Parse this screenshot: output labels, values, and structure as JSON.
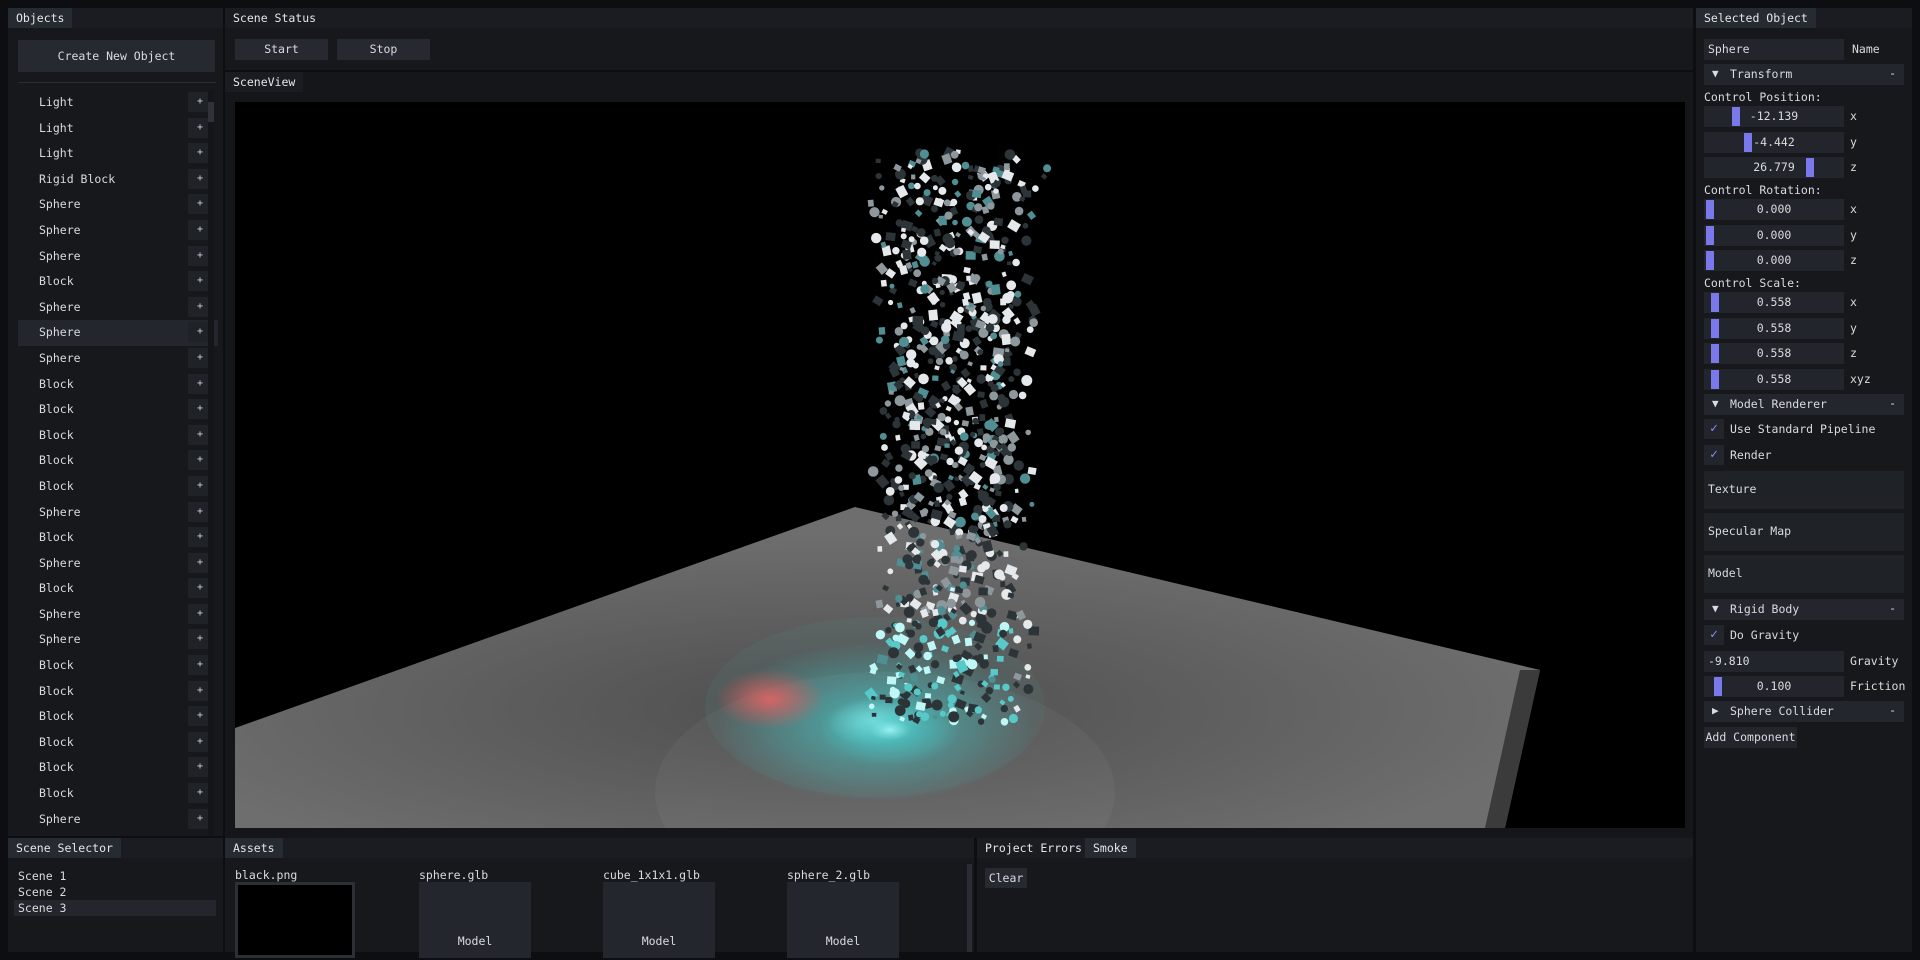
{
  "objects": {
    "title": "Objects",
    "create_button": "Create New Object",
    "add_symbol": "+",
    "items": [
      {
        "label": "Light"
      },
      {
        "label": "Light"
      },
      {
        "label": "Light"
      },
      {
        "label": "Rigid Block"
      },
      {
        "label": "Sphere"
      },
      {
        "label": "Sphere"
      },
      {
        "label": "Sphere"
      },
      {
        "label": "Block"
      },
      {
        "label": "Sphere"
      },
      {
        "label": "Sphere",
        "selected": true
      },
      {
        "label": "Sphere"
      },
      {
        "label": "Block"
      },
      {
        "label": "Block"
      },
      {
        "label": "Block"
      },
      {
        "label": "Block"
      },
      {
        "label": "Block"
      },
      {
        "label": "Sphere"
      },
      {
        "label": "Block"
      },
      {
        "label": "Sphere"
      },
      {
        "label": "Block"
      },
      {
        "label": "Sphere"
      },
      {
        "label": "Sphere"
      },
      {
        "label": "Block"
      },
      {
        "label": "Block"
      },
      {
        "label": "Block"
      },
      {
        "label": "Block"
      },
      {
        "label": "Block"
      },
      {
        "label": "Block"
      },
      {
        "label": "Sphere"
      }
    ]
  },
  "scene_status": {
    "title": "Scene Status",
    "start": "Start",
    "stop": "Stop"
  },
  "scene_view": {
    "title": "SceneView"
  },
  "selected": {
    "title": "Selected Object",
    "name_value": "Sphere",
    "name_label": "Name",
    "transform": {
      "header": "Transform",
      "collapse": "-",
      "position_label": "Control Position:",
      "position": [
        {
          "value": "-12.139",
          "axis": "x",
          "level": 0.2
        },
        {
          "value": "-4.442",
          "axis": "y",
          "level": 0.3
        },
        {
          "value": "26.779",
          "axis": "z",
          "level": 0.78
        }
      ],
      "rotation_label": "Control Rotation:",
      "rotation": [
        {
          "value": "0.000",
          "axis": "x",
          "level": 0.0
        },
        {
          "value": "0.000",
          "axis": "y",
          "level": 0.0
        },
        {
          "value": "0.000",
          "axis": "z",
          "level": 0.0
        }
      ],
      "scale_label": "Control Scale:",
      "scale": [
        {
          "value": "0.558",
          "axis": "x",
          "level": 0.04
        },
        {
          "value": "0.558",
          "axis": "y",
          "level": 0.04
        },
        {
          "value": "0.558",
          "axis": "z",
          "level": 0.04
        },
        {
          "value": "0.558",
          "axis": "xyz",
          "level": 0.04
        }
      ]
    },
    "model_renderer": {
      "header": "Model Renderer",
      "collapse": "-",
      "use_standard": "Use Standard Pipeline",
      "render": "Render",
      "texture": "Texture",
      "specular": "Specular Map",
      "model": "Model"
    },
    "rigid_body": {
      "header": "Rigid Body",
      "collapse": "-",
      "gravity_toggle": "Do Gravity",
      "gravity_value": "-9.810",
      "gravity_label": "Gravity",
      "friction_value": "0.100",
      "friction_label": "Friction",
      "friction_level": 0.06
    },
    "sphere_collider": {
      "header": "Sphere Collider",
      "collapse": "-"
    },
    "add_component": "Add Component",
    "check_mark": "✓"
  },
  "scene_selector": {
    "title": "Scene Selector",
    "scenes": [
      "Scene 1",
      "Scene 2",
      "Scene 3"
    ]
  },
  "assets": {
    "title": "Assets",
    "items": [
      {
        "name": "black.png",
        "kind": ""
      },
      {
        "name": "sphere.glb",
        "kind": "Model"
      },
      {
        "name": "cube_1x1x1.glb",
        "kind": "Model"
      },
      {
        "name": "sphere_2.glb",
        "kind": "Model"
      }
    ]
  },
  "errors": {
    "tab1": "Project Errors",
    "tab2": "Smoke",
    "clear": "Clear"
  },
  "colors": {
    "accent": "#7a79ec",
    "particle": "#57c9c9",
    "light_red": "#ff5050"
  }
}
